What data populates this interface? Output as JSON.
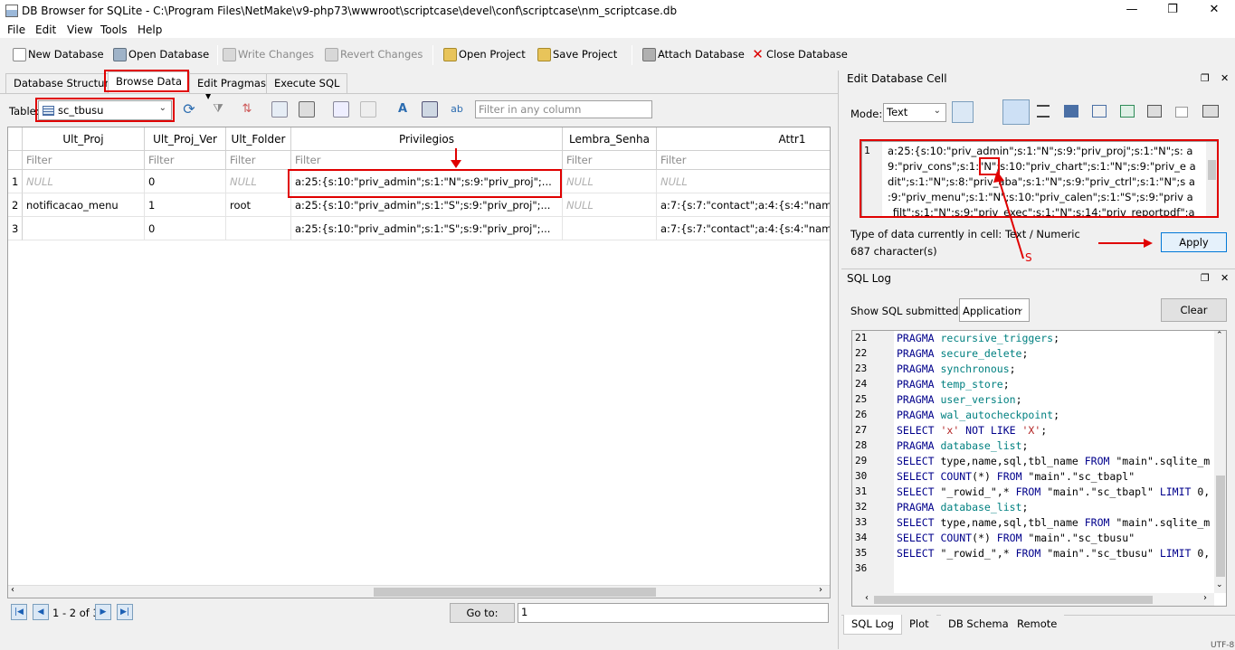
{
  "window": {
    "title": "DB Browser for SQLite - C:\\Program Files\\NetMake\\v9-php73\\wwwroot\\scriptcase\\devel\\conf\\scriptcase\\nm_scriptcase.db",
    "minimize": "—",
    "restore": "❐",
    "close": "✕"
  },
  "menu": [
    "File",
    "Edit",
    "View",
    "Tools",
    "Help"
  ],
  "toolbar": {
    "new_db": "New Database",
    "open_db": "Open Database",
    "write_changes": "Write Changes",
    "revert_changes": "Revert Changes",
    "open_project": "Open Project",
    "save_project": "Save Project",
    "attach_db": "Attach Database",
    "close_db": "Close Database"
  },
  "main_tabs": [
    "Database Structure",
    "Browse Data",
    "Edit Pragmas",
    "Execute SQL"
  ],
  "browse": {
    "table_label": "Table:",
    "table_selected": "sc_tbusu",
    "filter_any_placeholder": "Filter in any column",
    "columns": [
      "Ult_Proj",
      "Ult_Proj_Ver",
      "Ult_Folder",
      "Privilegios",
      "Lembra_Senha",
      "Attr1"
    ],
    "filter_placeholder": "Filter",
    "rows": [
      {
        "n": "1",
        "cells": [
          "NULL",
          "0",
          "NULL",
          "a:25:{s:10:\"priv_admin\";s:1:\"N\";s:9:\"priv_proj\";...",
          "NULL",
          "NULL"
        ]
      },
      {
        "n": "2",
        "cells": [
          "notificacao_menu",
          "1",
          "root",
          "a:25:{s:10:\"priv_admin\";s:1:\"S\";s:9:\"priv_proj\";...",
          "NULL",
          "a:7:{s:7:\"contact\";a:4:{s:4:\"nam"
        ]
      },
      {
        "n": "3",
        "cells": [
          "",
          "0",
          "",
          "a:25:{s:10:\"priv_admin\";s:1:\"S\";s:9:\"priv_proj\";...",
          "",
          "a:7:{s:7:\"contact\";a:4:{s:4:\"nam"
        ]
      }
    ],
    "nav_status": "1 - 2 of 3",
    "goto_label": "Go to:",
    "goto_value": "1"
  },
  "edit_cell": {
    "title": "Edit Database Cell",
    "mode_label": "Mode:",
    "mode_value": "Text",
    "editor_line_no": "1",
    "editor_lines": [
      "a:25:{s:10:\"priv_admin\";s:1:\"N\";s:9:\"priv_proj\";s:1:\"N\";s: a",
      "9:\"priv_cons\";s:1:\"N\";s:10:\"priv_chart\";s:1:\"N\";s:9:\"priv_e a",
      "dit\";s:1:\"N\";s:8:\"priv_aba\";s:1:\"N\";s:9:\"priv_ctrl\";s:1:\"N\";s a",
      ":9:\"priv_menu\";s:1:\"N\";s:10:\"priv_calen\";s:1:\"S\";s:9:\"priv a",
      "_filt\";s:1:\"N\";s:9:\"priv_exec\";s:1:\"N\";s:14:\"priv_reportpdf\";a"
    ],
    "type_info": "Type of data currently in cell: Text / Numeric",
    "char_count": "687 character(s)",
    "apply": "Apply",
    "annotation": "S"
  },
  "sql_log": {
    "title": "SQL Log",
    "show_label": "Show SQL submitted by",
    "show_value": "Application",
    "clear": "Clear",
    "lines": [
      {
        "n": "21",
        "parts": [
          [
            "kw",
            "PRAGMA "
          ],
          [
            "tok",
            "recursive_triggers"
          ],
          [
            "",
            "; "
          ]
        ]
      },
      {
        "n": "22",
        "parts": [
          [
            "kw",
            "PRAGMA "
          ],
          [
            "tok",
            "secure_delete"
          ],
          [
            "",
            ";"
          ]
        ]
      },
      {
        "n": "23",
        "parts": [
          [
            "kw",
            "PRAGMA "
          ],
          [
            "tok",
            "synchronous"
          ],
          [
            "",
            ";"
          ]
        ]
      },
      {
        "n": "24",
        "parts": [
          [
            "kw",
            "PRAGMA "
          ],
          [
            "tok",
            "temp_store"
          ],
          [
            "",
            ";"
          ]
        ]
      },
      {
        "n": "25",
        "parts": [
          [
            "kw",
            "PRAGMA "
          ],
          [
            "tok",
            "user_version"
          ],
          [
            "",
            ";"
          ]
        ]
      },
      {
        "n": "26",
        "parts": [
          [
            "kw",
            "PRAGMA "
          ],
          [
            "tok",
            "wal_autocheckpoint"
          ],
          [
            "",
            ";"
          ]
        ]
      },
      {
        "n": "27",
        "parts": [
          [
            "kw",
            "SELECT "
          ],
          [
            "str",
            "'x'"
          ],
          [
            "kw",
            " NOT LIKE "
          ],
          [
            "str",
            "'X'"
          ],
          [
            "",
            ";"
          ]
        ]
      },
      {
        "n": "28",
        "parts": [
          [
            "kw",
            "PRAGMA "
          ],
          [
            "tok",
            "database_list"
          ],
          [
            "",
            ";"
          ]
        ]
      },
      {
        "n": "29",
        "parts": [
          [
            "kw",
            "SELECT "
          ],
          [
            "",
            "type,name,sql,tbl_name "
          ],
          [
            "kw",
            "FROM "
          ],
          [
            "",
            "\"main\".sqlite_m"
          ]
        ]
      },
      {
        "n": "30",
        "parts": [
          [
            "kw",
            "SELECT "
          ],
          [
            "kw",
            "COUNT"
          ],
          [
            "",
            "(*) "
          ],
          [
            "kw",
            "FROM "
          ],
          [
            "",
            "\"main\".\"sc_tbapl\""
          ]
        ]
      },
      {
        "n": "31",
        "parts": [
          [
            "kw",
            "SELECT "
          ],
          [
            "",
            "\"_rowid_\",* "
          ],
          [
            "kw",
            "FROM "
          ],
          [
            "",
            "\"main\".\"sc_tbapl\" "
          ],
          [
            "kw",
            "LIMIT "
          ],
          [
            "",
            "0,"
          ]
        ]
      },
      {
        "n": "32",
        "parts": [
          [
            "kw",
            "PRAGMA "
          ],
          [
            "tok",
            "database_list"
          ],
          [
            "",
            ";"
          ]
        ]
      },
      {
        "n": "33",
        "parts": [
          [
            "kw",
            "SELECT "
          ],
          [
            "",
            "type,name,sql,tbl_name "
          ],
          [
            "kw",
            "FROM "
          ],
          [
            "",
            "\"main\".sqlite_m"
          ]
        ]
      },
      {
        "n": "34",
        "parts": [
          [
            "kw",
            "SELECT "
          ],
          [
            "kw",
            "COUNT"
          ],
          [
            "",
            "(*) "
          ],
          [
            "kw",
            "FROM "
          ],
          [
            "",
            "\"main\".\"sc_tbusu\""
          ]
        ]
      },
      {
        "n": "35",
        "parts": [
          [
            "kw",
            "SELECT "
          ],
          [
            "",
            "\"_rowid_\",* "
          ],
          [
            "kw",
            "FROM "
          ],
          [
            "",
            "\"main\".\"sc_tbusu\" "
          ],
          [
            "kw",
            "LIMIT "
          ],
          [
            "",
            "0,"
          ]
        ]
      },
      {
        "n": "36",
        "parts": []
      }
    ]
  },
  "bottom_tabs": [
    "SQL Log",
    "Plot",
    "DB Schema",
    "Remote"
  ],
  "status": "UTF-8"
}
